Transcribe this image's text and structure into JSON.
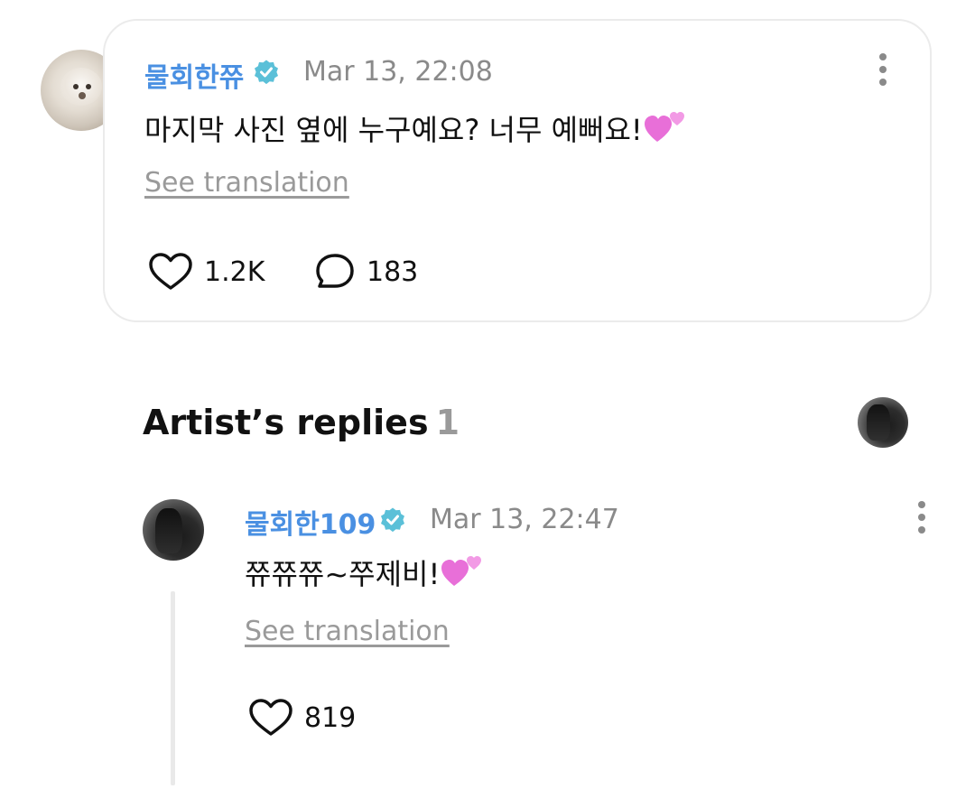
{
  "comment": {
    "author": "물회한쮸",
    "verified": true,
    "timestamp": "Mar 13, 22:08",
    "text": "마지막 사진 옆에 누구예요? 너무 예뻐요!",
    "emoji": "two-hearts",
    "see_translation": "See translation",
    "likes": "1.2K",
    "replies": "183"
  },
  "artist_replies": {
    "title": "Artist’s replies",
    "count": "1",
    "items": [
      {
        "author": "물회한109",
        "verified": true,
        "timestamp": "Mar 13, 22:47",
        "text": "쮸쮸쮸~쭈제비!",
        "emoji": "two-hearts",
        "see_translation": "See translation",
        "likes": "819"
      }
    ]
  },
  "colors": {
    "name": "#4a90e2",
    "verified_badge": "#5bc0d8",
    "muted": "#8a8a8a",
    "border": "#ebebeb",
    "emoji_heart": "#e86fd8"
  },
  "icons": [
    "verified-badge-icon",
    "more-vertical-icon",
    "heart-outline-icon",
    "comment-bubble-icon",
    "two-hearts-emoji"
  ]
}
